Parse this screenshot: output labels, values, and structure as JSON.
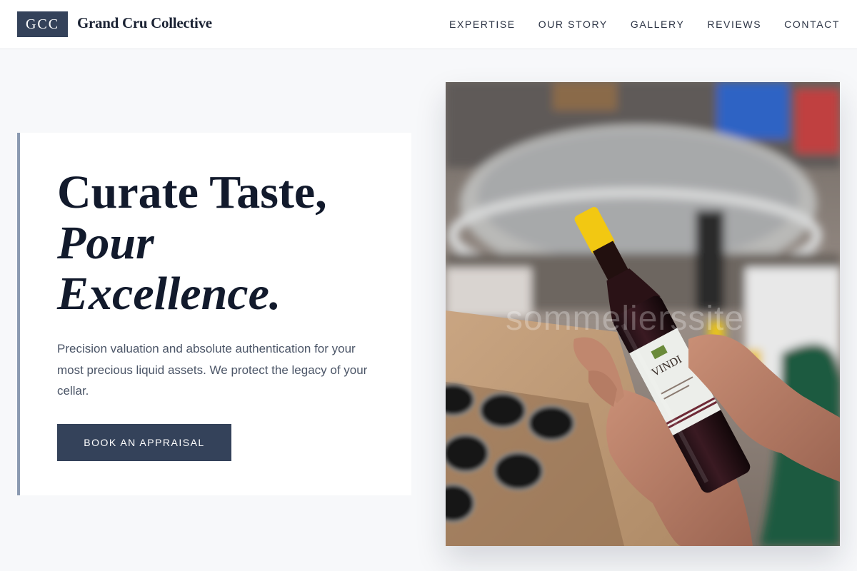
{
  "header": {
    "logo_text": "GCC",
    "brand_name": "Grand Cru Collective",
    "nav": [
      {
        "label": "EXPERTISE"
      },
      {
        "label": "OUR STORY"
      },
      {
        "label": "GALLERY"
      },
      {
        "label": "REVIEWS"
      },
      {
        "label": "CONTACT"
      }
    ]
  },
  "hero": {
    "headline_line1": "Curate Taste,",
    "headline_line2": "Pour",
    "headline_line3": "Excellence.",
    "description": "Precision valuation and absolute authentication for your most precious liquid assets. We protect the legacy of your cellar.",
    "cta_label": "BOOK AN APPRAISAL",
    "image": {
      "watermark": "sommelierssite",
      "label_text": "VINDI"
    }
  },
  "colors": {
    "brand_navy": "#34425a",
    "accent_border": "#8b9ab1",
    "page_background": "#f7f8fa"
  }
}
